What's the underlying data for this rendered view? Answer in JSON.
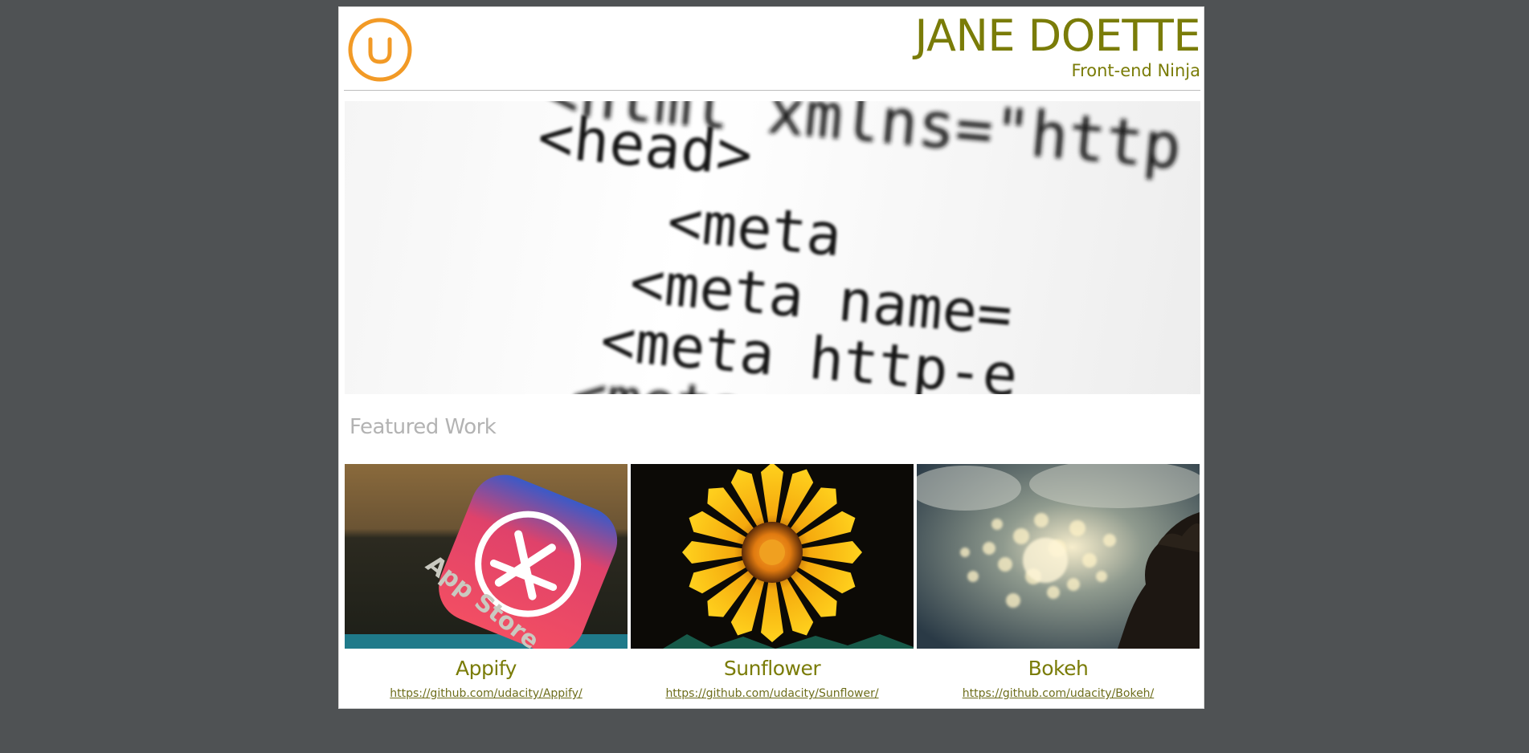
{
  "header": {
    "logo_letter": "U",
    "name": "JANE DOETTE",
    "role": "Front-end Ninja"
  },
  "hero": {
    "code_lines": [
      "<html xmlns=\"http",
      "<head>",
      "<meta",
      "<meta name=",
      "<meta http-e",
      "<meta"
    ]
  },
  "featured": {
    "title": "Featured Work",
    "projects": [
      {
        "title": "Appify",
        "url": "https://github.com/udacity/Appify/",
        "image_text": "App Store"
      },
      {
        "title": "Sunflower",
        "url": "https://github.com/udacity/Sunflower/"
      },
      {
        "title": "Bokeh",
        "url": "https://github.com/udacity/Bokeh/"
      }
    ]
  },
  "colors": {
    "background": "#4f5254",
    "accent": "#7a7c08",
    "logo": "#f29a26",
    "section_title": "#b3b3b3"
  }
}
